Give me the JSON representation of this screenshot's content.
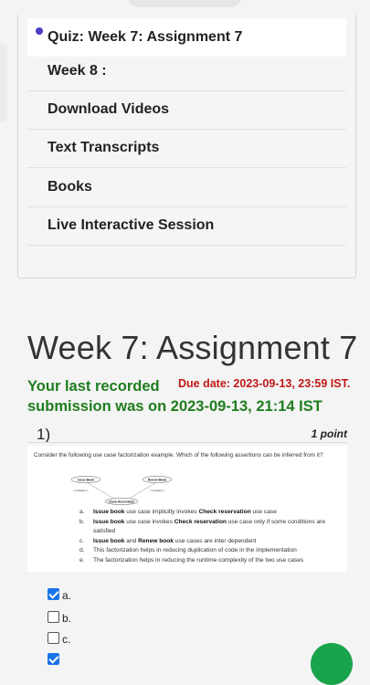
{
  "nav": {
    "items": [
      {
        "label": "Quiz: Week 7: Assignment 7",
        "active": true
      },
      {
        "label": "Week 8 :"
      },
      {
        "label": "Download Videos"
      },
      {
        "label": "Text Transcripts"
      },
      {
        "label": "Books"
      },
      {
        "label": "Live Interactive Session"
      }
    ]
  },
  "assignment": {
    "title": "Week 7: Assignment 7",
    "last_submission_line1": "Your last recorded",
    "last_submission_line2": "submission was on 2023-09-13, 21:14 IST",
    "due_date": "Due date: 2023-09-13, 23:59 IST."
  },
  "question": {
    "number": "1)",
    "points": "1 point",
    "text": "Consider the following use case factorization example. Which of the following assertions can be inferred from it?",
    "diagram": {
      "issue": "Issue Book",
      "renew": "Renew Book",
      "check": "Check Reservation",
      "include_left": "<<include>>",
      "include_right": "<<include>>"
    },
    "options": [
      {
        "letter": "a.",
        "parts": [
          {
            "b": "Issue book"
          },
          {
            "t": " use case implicitly invokes "
          },
          {
            "b": "Check reservation"
          },
          {
            "t": " use case"
          }
        ]
      },
      {
        "letter": "b.",
        "parts": [
          {
            "b": "Issue book"
          },
          {
            "t": " use case invokes "
          },
          {
            "b": "Check reservation"
          },
          {
            "t": " use case only if some conditions are satisfied"
          }
        ]
      },
      {
        "letter": "c.",
        "parts": [
          {
            "b": "Issue book"
          },
          {
            "t": " and "
          },
          {
            "b": "Renew book"
          },
          {
            "t": " use cases are inter dependent"
          }
        ]
      },
      {
        "letter": "d.",
        "parts": [
          {
            "t": "This factorization helps in reducing duplication of code in the implementation"
          }
        ]
      },
      {
        "letter": "e.",
        "parts": [
          {
            "t": "The factorization helps in reducing the runtime complexity of the two use cases"
          }
        ]
      }
    ],
    "choices": [
      {
        "label": "a.",
        "checked": true
      },
      {
        "label": "b.",
        "checked": false
      },
      {
        "label": "c.",
        "checked": false
      },
      {
        "label": "",
        "checked": true
      }
    ]
  },
  "colors": {
    "active_dot": "#4a3fc4",
    "submission_green": "#1e7d1e",
    "due_red": "#c01818",
    "checkbox_blue": "#1a73e8",
    "fab_green": "#19a34a"
  }
}
